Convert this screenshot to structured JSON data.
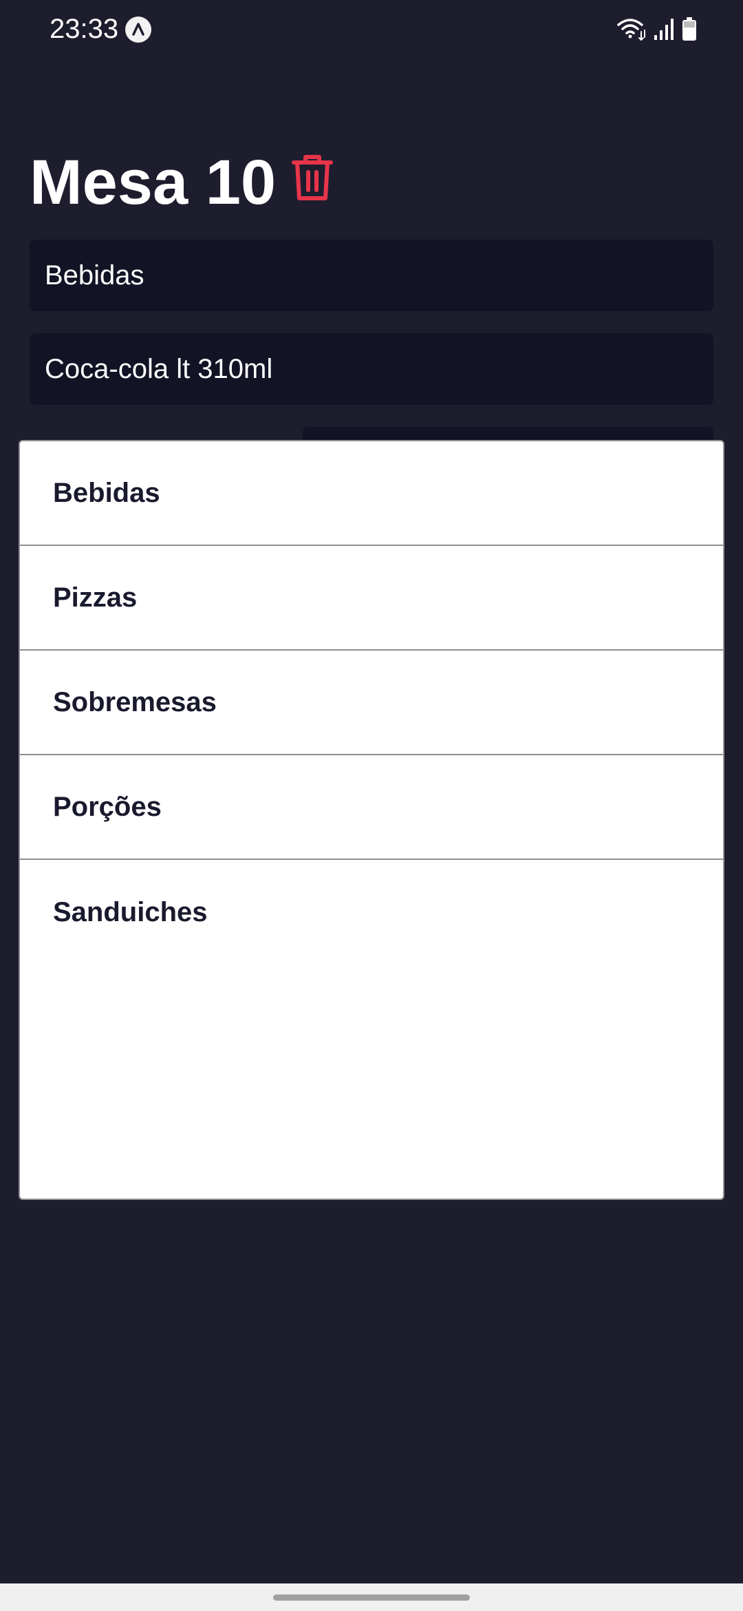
{
  "status_bar": {
    "time": "23:33",
    "icons": [
      "app-notification-icon",
      "wifi-icon",
      "signal-icon",
      "battery-icon"
    ]
  },
  "header": {
    "title": "Mesa 10",
    "delete_icon": "trash-icon",
    "delete_color": "#e8344a"
  },
  "form": {
    "category_value": "Bebidas",
    "product_value": "Coca-cola lt 310ml"
  },
  "dropdown": {
    "options": [
      "Bebidas",
      "Pizzas",
      "Sobremesas",
      "Porções",
      "Sanduiches"
    ]
  },
  "colors": {
    "background": "#1d1d2e",
    "field_background": "#131326",
    "sheet_background": "#ffffff",
    "option_text": "#1a1a2e"
  }
}
